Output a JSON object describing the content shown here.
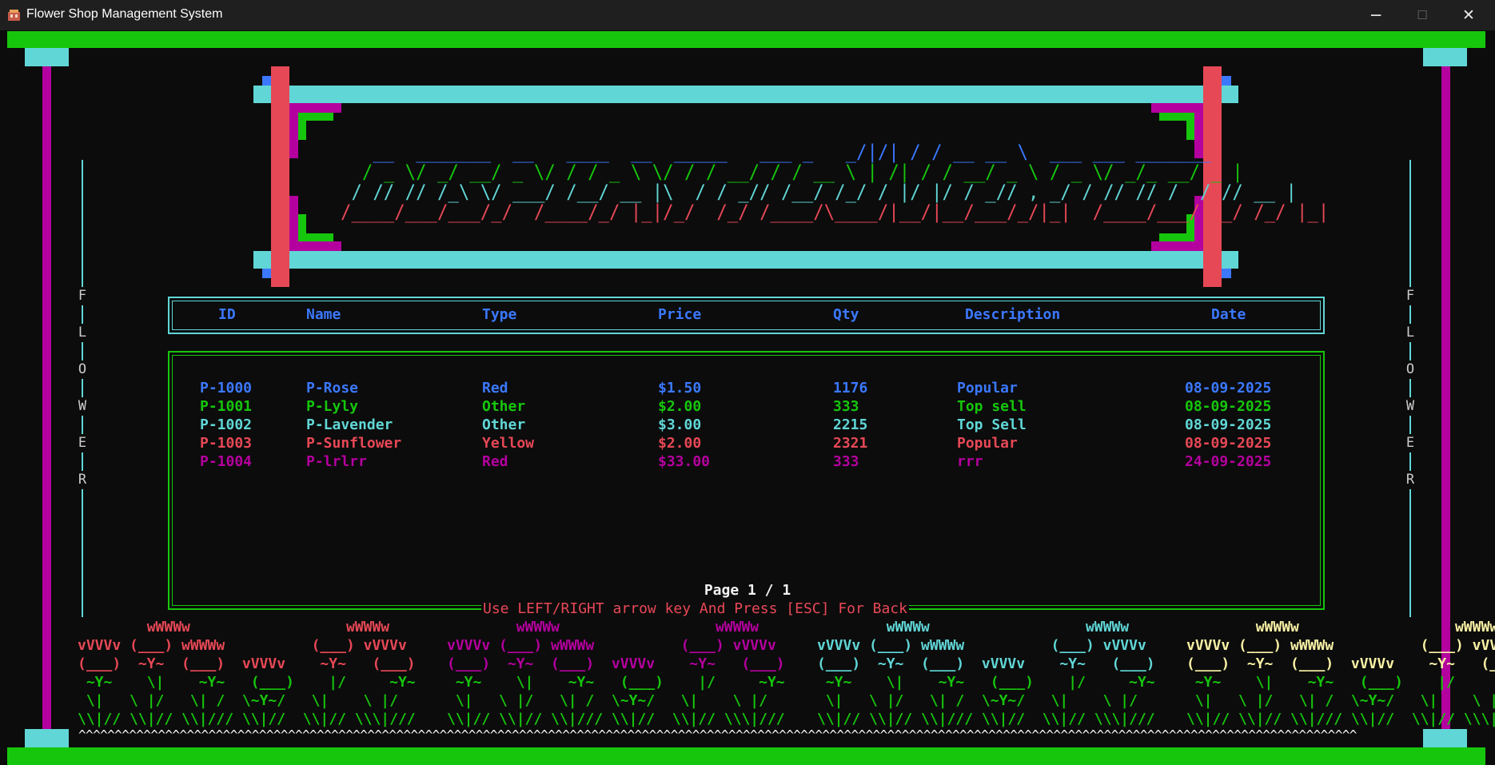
{
  "window": {
    "title": "Flower Shop Management System",
    "minimize_glyph": "─",
    "maximize_glyph": "☐",
    "close_glyph": "✕"
  },
  "colors": {
    "green": "#16c60c",
    "cyan": "#61d6d6",
    "magenta": "#b4009e",
    "red": "#e74856",
    "blue": "#3b78ff",
    "yellow": "#f9f1a5"
  },
  "side_label": [
    "F",
    "L",
    "O",
    "W",
    "E",
    "R"
  ],
  "banner_ascii": [
    "   __  _______  __   ____  __  _____   ___ _   _/|/| / / __ __ \\  ___ ___ _______",
    "  / _ \\/ _/ __/ _ \\/ / / _ \\ \\/ / / __/ / / __ \\ | /| / / __/ _ \\ / _ \\/ _/_ __/ _ |",
    " / // // /_\\ \\/ ___/ /__/ __ |\\  / / _// /__/ /_/ / |/ |/ / _// , _/ / // // /  / // __ |",
    "/____/___/___/_/  /____/_/ |_|/_/  /_/ /____/\\____/|__/|__/___/_/|_|  /____/___/ /_/ /_/ |_|"
  ],
  "table": {
    "headers": [
      "ID",
      "Name",
      "Type",
      "Price",
      "Qty",
      "Description",
      "Date"
    ],
    "rows": [
      [
        "P-1000",
        "P-Rose",
        "Red",
        "$1.50",
        "1176",
        "Popular",
        "08-09-2025"
      ],
      [
        "P-1001",
        "P-Lyly",
        "Other",
        "$2.00",
        "333",
        "Top sell",
        "08-09-2025"
      ],
      [
        "P-1002",
        "P-Lavender",
        "Other",
        "$3.00",
        "2215",
        "Top Sell",
        "08-09-2025"
      ],
      [
        "P-1003",
        "P-Sunflower",
        "Yellow",
        "$2.00",
        "2321",
        "Popular",
        "08-09-2025"
      ],
      [
        "P-1004",
        "P-lrlrr",
        "Red",
        "$33.00",
        "333",
        "rrr",
        "24-09-2025"
      ]
    ],
    "row_colors": [
      "#3b78ff",
      "#16c60c",
      "#61d6d6",
      "#e74856",
      "#b4009e"
    ]
  },
  "pagination": {
    "page_info": "Page 1 / 1",
    "hint": "Use LEFT/RIGHT arrow key And Press [ESC] For Back"
  },
  "flowers": {
    "group_colors": [
      "#e74856",
      "#b4009e",
      "#61d6d6",
      "#f9f1a5"
    ],
    "row1": "        wWWWw                  wWWWw",
    "row2": "vVVVv (___) wWWWw          (___) vVVVv",
    "row3": "(___)  ~Y~  (___)  vVVVv    ~Y~   (___)",
    "stem1": " ~Y~    \\|    ~Y~   (___)    |/     ~Y~",
    "stem2": " \\|   \\ |/   \\| /  \\~Y~/   \\|    \\ |/",
    "stem3": "\\\\|// \\\\|// \\\\|/// \\\\|//  \\\\|// \\\\\\|///",
    "grass": "^^^^^^^^^^^^^^^^^^^^^^^^^^^^^^^^^^^^^^^^^^^^^^^^^^^^^^^^^^^^^^^^^^^^^^^^^^^^^^^^^^^^^^^^^^^^^^^^^^^^^^^^^^^^^^^^^^^^^^^^^^^^^^^^^^^^^^^^^^^^^^^^^^^^^^^^^^^^^^^^^^^^^^^^^^^^^^^^^"
  }
}
